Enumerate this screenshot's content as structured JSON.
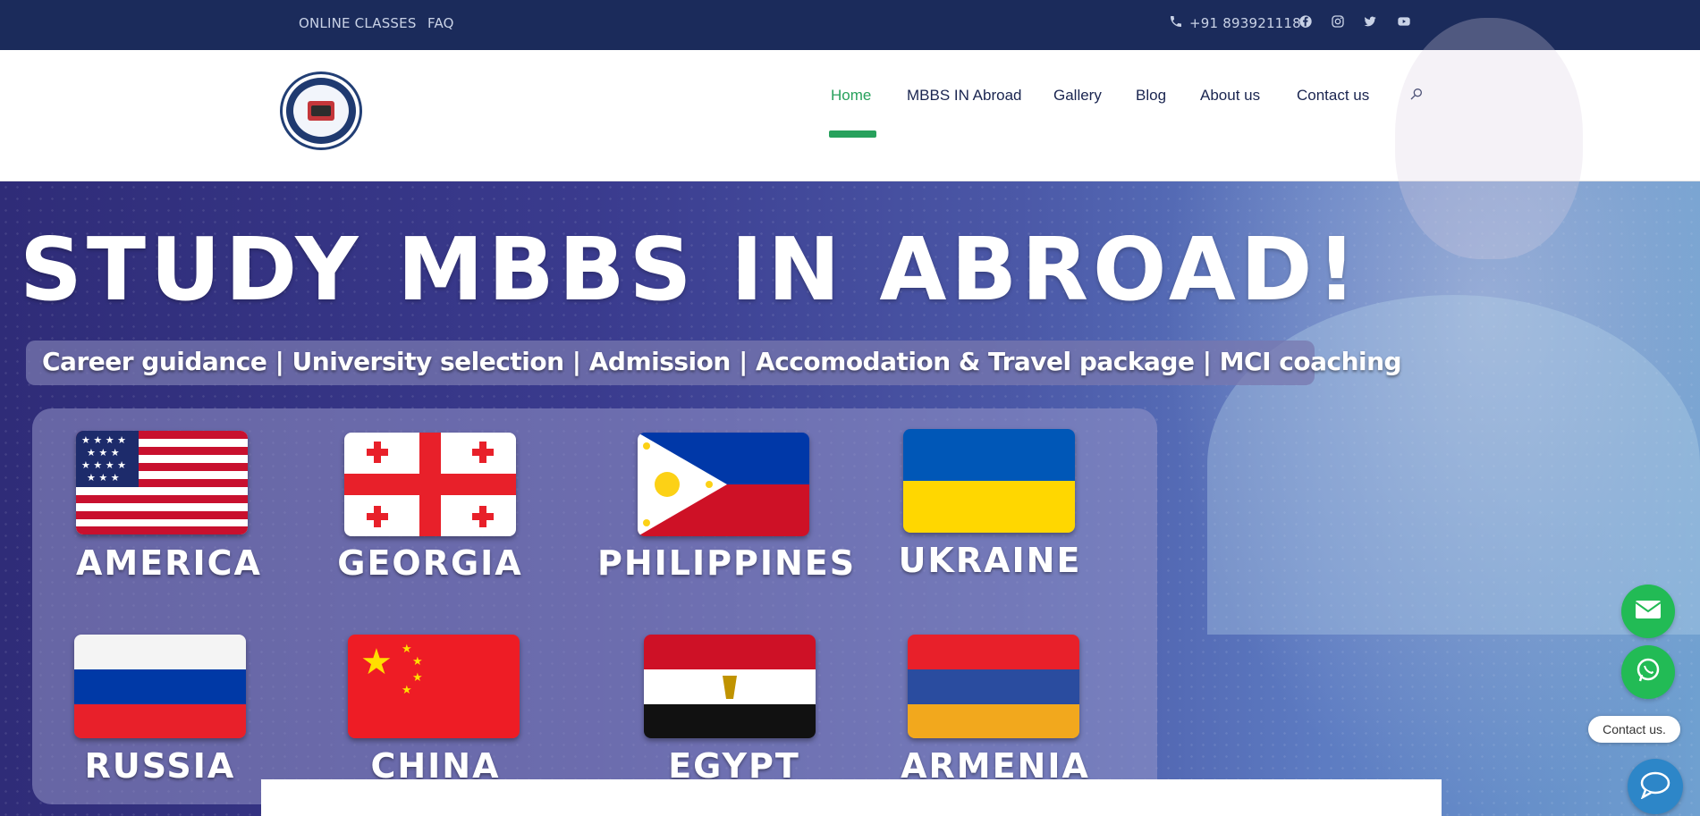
{
  "topbar": {
    "links": [
      "ONLINE CLASSES",
      "FAQ"
    ],
    "phone": "+91 8939211180",
    "social_icons": [
      "facebook-icon",
      "instagram-icon",
      "twitter-icon",
      "youtube-icon"
    ],
    "background": "#1b2b5b"
  },
  "header": {
    "nav": [
      "Home",
      "MBBS IN Abroad",
      "Gallery",
      "Blog",
      "About us",
      "Contact us"
    ],
    "active_nav": "Home",
    "accent": "#27a15c"
  },
  "hero": {
    "title": "STUDY MBBS IN ABROAD!",
    "tagline": "Career guidance | University selection | Admission | Accomodation & Travel package | MCI coaching",
    "countries": [
      {
        "name": "AMERICA",
        "flag": "usa-flag"
      },
      {
        "name": "GEORGIA",
        "flag": "georgia-flag"
      },
      {
        "name": "PHILIPPINES",
        "flag": "philippines-flag"
      },
      {
        "name": "UKRAINE",
        "flag": "ukraine-flag"
      },
      {
        "name": "RUSSIA",
        "flag": "russia-flag"
      },
      {
        "name": "CHINA",
        "flag": "china-flag"
      },
      {
        "name": "EGYPT",
        "flag": "egypt-flag"
      },
      {
        "name": "ARMENIA",
        "flag": "armenia-flag"
      }
    ]
  },
  "floating": {
    "contact_label": "Contact us.",
    "buttons": [
      "mail-icon",
      "whatsapp-icon",
      "chat-icon"
    ]
  }
}
